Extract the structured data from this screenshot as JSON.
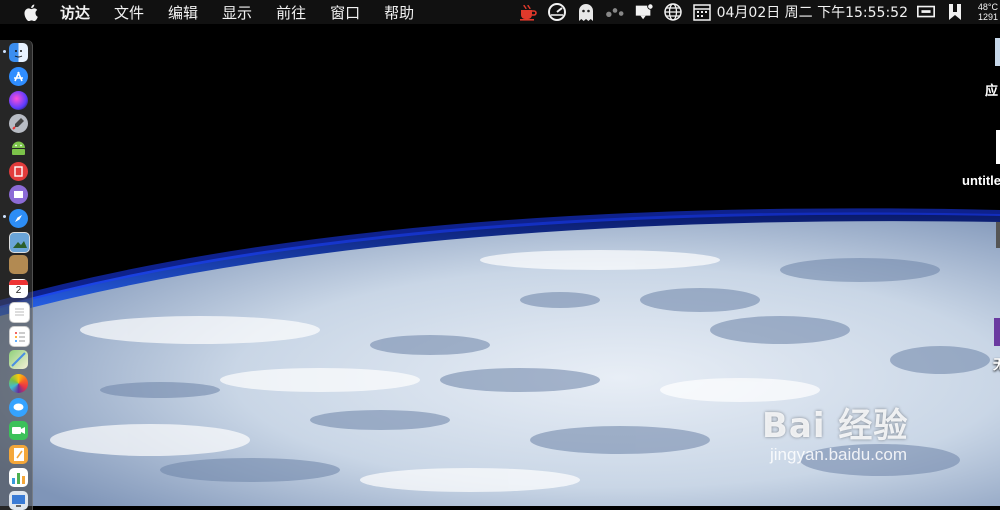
{
  "menubar": {
    "apple_icon": "apple-logo-icon",
    "items": [
      "访达",
      "文件",
      "编辑",
      "显示",
      "前往",
      "窗口",
      "帮助"
    ],
    "clock": "04月02日 周二 下午15:55:52",
    "weather_temp": "48°C",
    "weather_sub": "1291",
    "status_icons": [
      "coffee-cup-icon",
      "speedometer-icon",
      "ghost-icon",
      "dots-icon",
      "notification-icon",
      "globe-icon",
      "calendar-icon",
      "display-icon",
      "bookmark-icon"
    ]
  },
  "dock": {
    "items": [
      "finder-icon",
      "app-store-icon",
      "siri-icon",
      "launchpad-icon",
      "android-icon",
      "red-app-icon",
      "purple-app-icon",
      "safari-icon",
      "preview-icon",
      "notes-brown-icon",
      "calendar-icon",
      "notes-icon",
      "reminders-icon",
      "maps-icon",
      "photos-icon",
      "messages-icon",
      "facetime-icon",
      "pages-icon",
      "numbers-icon",
      "monitor-icon"
    ],
    "calendar_day": "2"
  },
  "desktop": {
    "labels": [
      "应",
      "untitle",
      "无"
    ]
  },
  "watermark": {
    "brand": "Bai 经验",
    "url": "jingyan.baidu.com"
  }
}
